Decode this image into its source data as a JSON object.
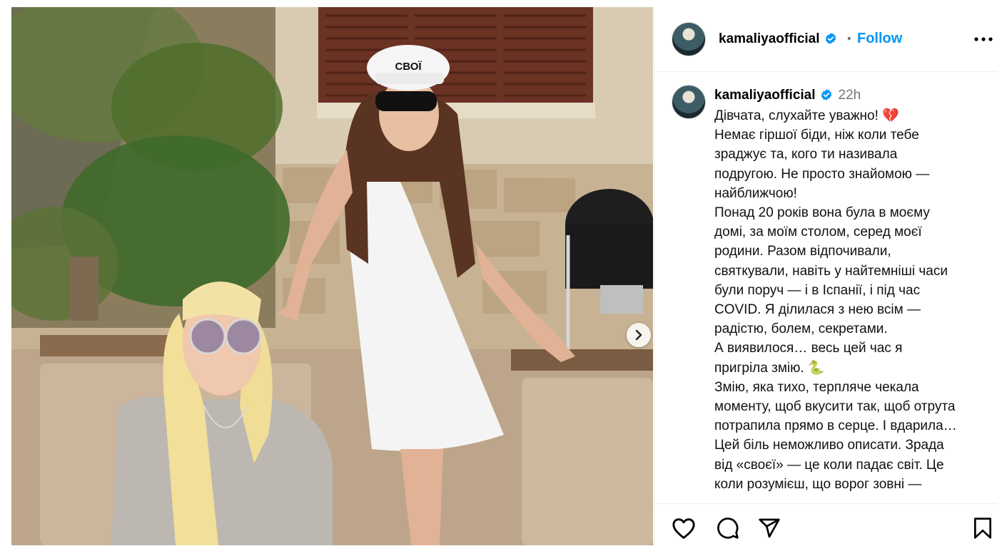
{
  "post": {
    "username": "kamaliyaofficial",
    "follow_label": "Follow",
    "separator": "•",
    "timestamp": "22h",
    "caption_lines": [
      "Дівчата, слухайте уважно! 💔",
      "Немає гіршої біди, ніж коли тебе зраджує та, кого ти називала подругою. Не просто знайомою — найближчою!",
      "Понад 20 років вона була в моєму домі, за моїм столом, серед моєї родини. Разом відпочивали, святкували, навіть у найтемніші часи були поруч — і в Іспанії, і під час COVID. Я ділилася з нею всім — радістю, болем, секретами.",
      "А виявилося… весь цей час я пригріла змію. 🐍",
      "Змію, яка тихо, терпляче чекала моменту, щоб вкусити так, щоб отрута потрапила прямо в серце. І вдарила…",
      "Цей біль неможливо описати. Зрада від «своєї» — це коли падає світ. Це коли розумієш, що ворог зовні —"
    ]
  },
  "photo": {
    "cap_text": "СВОЇ"
  },
  "icons": {
    "verified": "verified-badge-icon",
    "more": "more-options-icon",
    "next": "chevron-right-icon",
    "like": "heart-icon",
    "comment": "comment-icon",
    "share": "share-icon",
    "save": "bookmark-icon"
  },
  "colors": {
    "accent": "#0095f6",
    "verified": "#0095f6",
    "muted": "#737373"
  }
}
